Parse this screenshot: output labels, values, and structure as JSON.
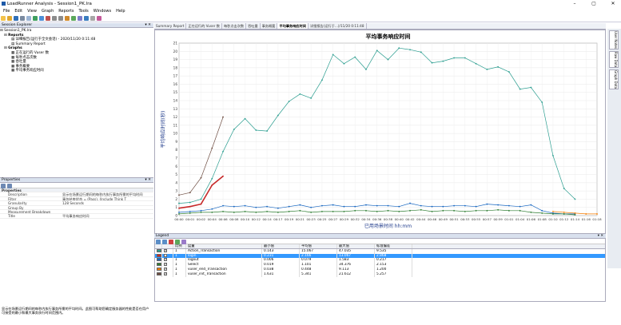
{
  "window": {
    "title": "LoadRunner Analysis - Session1_PK.lra",
    "minimize": "–",
    "maximize": "▢",
    "close": "✕"
  },
  "menu": [
    "File",
    "Edit",
    "View",
    "Graph",
    "Reports",
    "Tools",
    "Windows",
    "Help"
  ],
  "explorer": {
    "title": "Session Explorer",
    "pin": "▾ ✕",
    "root": "Session1_PK.lra",
    "reports_label": "Reports",
    "report_items": [
      "详细报告(运行于全文会话) - 2020/11/20 0:11:48",
      "Summary Report"
    ],
    "graphs_label": "Graphs",
    "graph_items": [
      "正在运行的 Vuser 数",
      "每秒点击次数",
      "吞吐量",
      "事务概要",
      "平均事务响应时间"
    ]
  },
  "properties": {
    "title": "Properties",
    "pin": "▾ ✕",
    "section": "Properties",
    "rows": [
      {
        "k": "Description",
        "v": "显示在场景运行期间的每秒内执行事务所需的平均时间"
      },
      {
        "k": "Filter",
        "v": "事务结束状态 = (Pass), (Include Think T"
      },
      {
        "k": "Granularity",
        "v": "128 Seconds"
      },
      {
        "k": "Group By",
        "v": ""
      },
      {
        "k": "Measurement Breakdown",
        "v": ""
      },
      {
        "k": "Title",
        "v": "平均事务响应时间"
      }
    ],
    "footer": "显示在场景运行期间的每秒内执行事务所需的平均时间。此图可帮助您确定服务器的性能是否在用户可接受的最小和最大事务执行时间范围内。"
  },
  "tabs": [
    {
      "label": "Summary Report",
      "active": false
    },
    {
      "label": "正在运行的 Vuser 数",
      "active": false
    },
    {
      "label": "每秒点击次数",
      "active": false
    },
    {
      "label": "吞吐量",
      "active": false
    },
    {
      "label": "事务概要",
      "active": false
    },
    {
      "label": "平均事务响应时间",
      "active": true
    },
    {
      "label": "详细报告(运行于...)/11/20 0:11:48",
      "active": false
    }
  ],
  "sidetabs": [
    "User Notes",
    "Raw Data",
    "Graph Data"
  ],
  "chart_data": {
    "type": "line",
    "title": "平均事务响应时间",
    "xlabel": "已用场景时间 hh:mm",
    "ylabel": "平均响应时间(秒)",
    "ylim": [
      0,
      21
    ],
    "yticks": [
      0,
      1,
      2,
      3,
      4,
      5,
      6,
      7,
      8,
      9,
      10,
      11,
      12,
      13,
      14,
      15,
      16,
      17,
      18,
      19,
      20,
      21
    ],
    "x": [
      "00:00",
      "00:01",
      "00:02",
      "00:04",
      "00:06",
      "00:08",
      "00:10",
      "00:12",
      "00:14",
      "00:17",
      "00:19",
      "00:21",
      "00:23",
      "00:25",
      "00:27",
      "00:29",
      "00:32",
      "00:34",
      "00:36",
      "00:38",
      "00:40",
      "00:42",
      "00:44",
      "00:46",
      "00:49",
      "00:51",
      "00:53",
      "00:55",
      "00:57",
      "00:59",
      "01:01",
      "01:04",
      "01:06",
      "01:08",
      "01:10",
      "01:12",
      "01:14",
      "01:16",
      "01:18"
    ],
    "series": [
      {
        "name": "Action_Transaction",
        "color": "#2a9d8f",
        "values": [
          1.5,
          1.6,
          2.0,
          4.5,
          7.8,
          10.5,
          11.8,
          10.4,
          10.3,
          12.2,
          13.9,
          14.8,
          14.3,
          16.5,
          19.6,
          18.5,
          19.3,
          17.8,
          20.1,
          19.0,
          20.4,
          20.2,
          19.9,
          18.6,
          18.8,
          19.2,
          19.2,
          18.5,
          17.8,
          18.1,
          17.5,
          15.4,
          15.6,
          13.8,
          7.3,
          3.3,
          2.0,
          null,
          null
        ]
      },
      {
        "name": "login",
        "color": "#c62828",
        "values": [
          0.9,
          1.1,
          1.4,
          3.7,
          4.8,
          null,
          null,
          null,
          null,
          null,
          null,
          null,
          null,
          null,
          null,
          null,
          null,
          null,
          null,
          null,
          null,
          null,
          null,
          null,
          null,
          null,
          null,
          null,
          null,
          null,
          null,
          null,
          null,
          null,
          null,
          null,
          null,
          null,
          null
        ]
      },
      {
        "name": "logout",
        "color": "#1565c0",
        "values": [
          0.4,
          0.5,
          0.6,
          0.8,
          1.2,
          1.1,
          1.2,
          1.0,
          1.1,
          0.9,
          1.1,
          1.3,
          1.0,
          1.2,
          1.3,
          1.1,
          1.1,
          1.3,
          1.2,
          1.2,
          1.1,
          1.5,
          1.2,
          1.1,
          1.1,
          1.2,
          1.2,
          1.1,
          1.4,
          1.3,
          1.2,
          1.1,
          1.3,
          0.6,
          0.3,
          0.2,
          0.2,
          null,
          null
        ]
      },
      {
        "name": "Select",
        "color": "#2e7d32",
        "values": [
          0.2,
          0.3,
          0.4,
          0.4,
          0.5,
          0.4,
          0.5,
          0.4,
          0.5,
          0.4,
          0.5,
          0.6,
          0.4,
          0.5,
          0.5,
          0.5,
          0.6,
          0.6,
          0.5,
          0.6,
          0.5,
          0.6,
          0.7,
          0.5,
          0.6,
          0.6,
          0.5,
          0.6,
          0.6,
          0.7,
          0.6,
          0.6,
          0.4,
          0.3,
          0.2,
          0.2,
          0.1,
          null,
          null
        ]
      },
      {
        "name": "vuser_end_Transaction",
        "color": "#f57c00",
        "values": [
          null,
          null,
          null,
          null,
          null,
          null,
          null,
          null,
          null,
          null,
          null,
          null,
          null,
          null,
          null,
          null,
          null,
          null,
          null,
          null,
          null,
          null,
          null,
          null,
          null,
          null,
          null,
          null,
          null,
          null,
          null,
          null,
          null,
          null,
          0.5,
          0.4,
          0.3,
          0.2,
          0.2
        ]
      },
      {
        "name": "vuser_init_Transaction",
        "color": "#6d4c41",
        "values": [
          2.5,
          2.8,
          4.6,
          8.2,
          12.0,
          null,
          null,
          null,
          null,
          null,
          null,
          null,
          null,
          null,
          null,
          null,
          null,
          null,
          null,
          null,
          null,
          null,
          null,
          null,
          null,
          null,
          null,
          null,
          null,
          null,
          null,
          null,
          null,
          null,
          null,
          null,
          null,
          null,
          null
        ]
      }
    ],
    "grid": true
  },
  "legend": {
    "title": "Legend",
    "pin": "▾ ✕",
    "headers": [
      "",
      "比例",
      "度量",
      "最小值",
      "平均值",
      "最大值",
      "标准偏差"
    ],
    "rows": [
      {
        "scale": "1",
        "measure": "Action_Transaction",
        "min": "0.143",
        "avg": "15.067",
        "max": "47.035",
        "sd": "9.535",
        "sel": false
      },
      {
        "scale": "1",
        "measure": "login",
        "min": "0.231",
        "avg": "2.166",
        "max": "13.067",
        "sd": "2.868",
        "sel": true
      },
      {
        "scale": "1",
        "measure": "logout",
        "min": "0.006",
        "avg": "0.079",
        "max": "1.583",
        "sd": "0.217",
        "sel": false
      },
      {
        "scale": "1",
        "measure": "Select",
        "min": "0.019",
        "avg": "1.101",
        "max": "34.376",
        "sd": "2.153",
        "sel": false
      },
      {
        "scale": "1",
        "measure": "vuser_end_Transaction",
        "min": "0.038",
        "avg": "0.448",
        "max": "9.113",
        "sd": "1.200",
        "sel": false
      },
      {
        "scale": "1",
        "measure": "vuser_init_Transaction",
        "min": "1.631",
        "avg": "5.341",
        "max": "21.612",
        "sd": "5.257",
        "sel": false
      }
    ]
  }
}
